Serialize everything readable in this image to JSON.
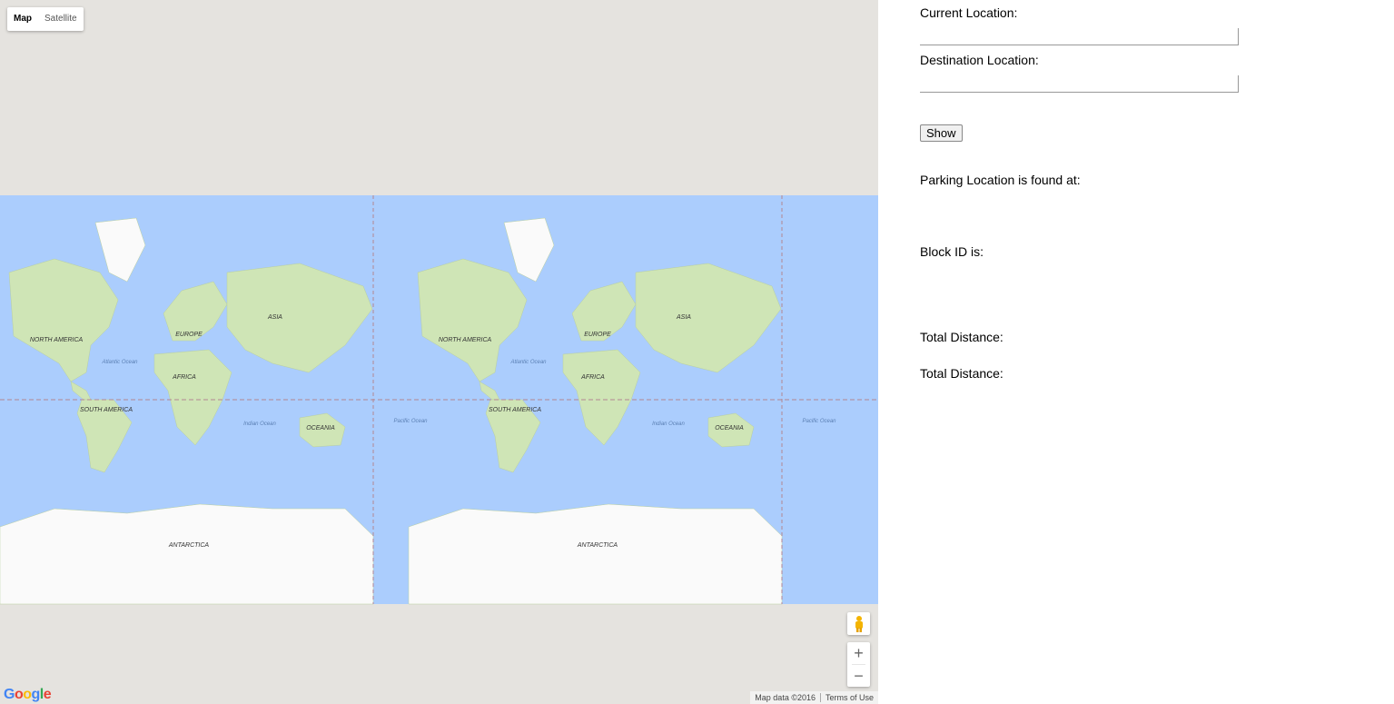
{
  "map": {
    "type_control": {
      "map_label": "Map",
      "satellite_label": "Satellite"
    },
    "labels": [
      "NORTH AMERICA",
      "SOUTH AMERICA",
      "EUROPE",
      "AFRICA",
      "ASIA",
      "OCEANIA",
      "ANTARCTICA",
      "Atlantic Ocean",
      "Indian Ocean",
      "Pacific Ocean"
    ],
    "zoom_in": "+",
    "zoom_out": "−",
    "logo": "Google",
    "map_data": "Map data ©2016",
    "terms": "Terms of Use",
    "colors": {
      "water": "#abcdfd",
      "land": "#cfe5b6",
      "ice": "#fafafa",
      "background": "#e5e3df"
    }
  },
  "form": {
    "current_location_label": "Current Location:",
    "current_location_value": "",
    "destination_location_label": "Destination Location:",
    "destination_location_value": "",
    "show_button": "Show",
    "parking_location_label": "Parking Location is found at:",
    "block_id_label": "Block ID is:",
    "total_distance_label_1": "Total Distance:",
    "total_distance_label_2": "Total Distance:"
  }
}
